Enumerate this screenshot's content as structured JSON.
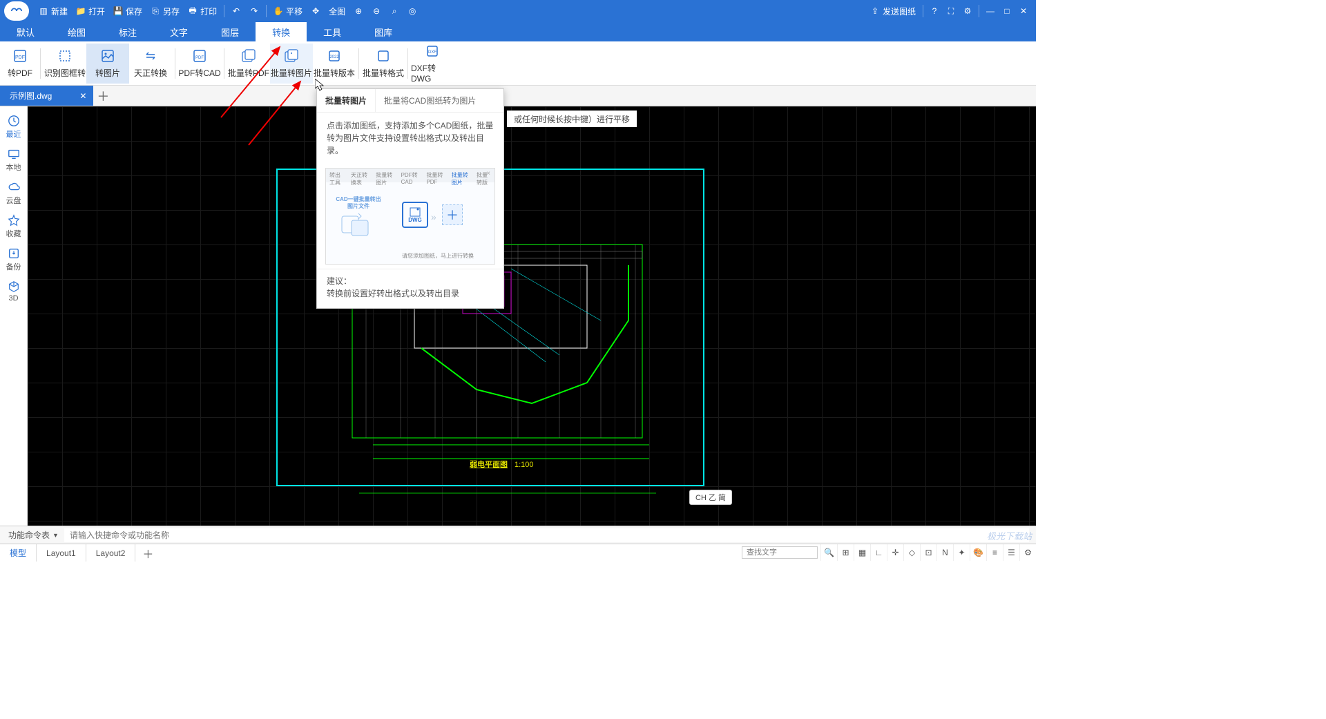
{
  "titlebar": {
    "new": "新建",
    "open": "打开",
    "save": "保存",
    "saveas": "另存",
    "print": "打印",
    "pan": "平移",
    "fit": "全图",
    "send": "发送图纸"
  },
  "menus": [
    "默认",
    "绘图",
    "标注",
    "文字",
    "图层",
    "转换",
    "工具",
    "图库"
  ],
  "active_menu": 5,
  "ribbon": [
    {
      "label": "转PDF"
    },
    {
      "label": "识别图框转"
    },
    {
      "label": "转图片",
      "active": true
    },
    {
      "label": "天正转换"
    },
    {
      "label": "PDF转CAD"
    },
    {
      "label": "批量转PDF"
    },
    {
      "label": "批量转图片",
      "hover": true
    },
    {
      "label": "批量转版本"
    },
    {
      "label": "批量转格式"
    },
    {
      "label": "DXF转DWG"
    }
  ],
  "doctab": {
    "name": "示例图.dwg"
  },
  "sidenav": [
    {
      "label": "最近",
      "icon": "clock"
    },
    {
      "label": "本地",
      "icon": "monitor"
    },
    {
      "label": "云盘",
      "icon": "cloud"
    },
    {
      "label": "收藏",
      "icon": "star"
    },
    {
      "label": "备份",
      "icon": "backup"
    },
    {
      "label": "3D",
      "icon": "cube"
    }
  ],
  "popup": {
    "title": "批量转图片",
    "subtitle": "批量将CAD图纸转为图片",
    "body": "点击添加图纸，支持添加多个CAD图纸，批量转为图片文件支持设置转出格式以及转出目录。",
    "illus_title": "CAD一键批量转出图片文件",
    "illus_tabs": [
      "转出工具",
      "天正转换表",
      "批量转图片",
      "PDF转CAD",
      "批量转PDF",
      "批量转图片",
      "批量转版"
    ],
    "illus_caption": "请您添加图纸，马上进行转换",
    "tip_label": "建议：",
    "tip_text": "转换前设置好转出格式以及转出目录"
  },
  "canvas": {
    "hint": "或任何时候长按中键）进行平移",
    "drawing_title": "弱电平面图",
    "drawing_scale": "1:100",
    "ime": "CH 乙 简"
  },
  "cmdbar": {
    "label": "功能命令表",
    "placeholder": "请输入快捷命令或功能名称"
  },
  "statusbar": {
    "tabs": [
      "模型",
      "Layout1",
      "Layout2"
    ],
    "active": 0,
    "find_placeholder": "查找文字"
  },
  "watermark": "极光下载站"
}
